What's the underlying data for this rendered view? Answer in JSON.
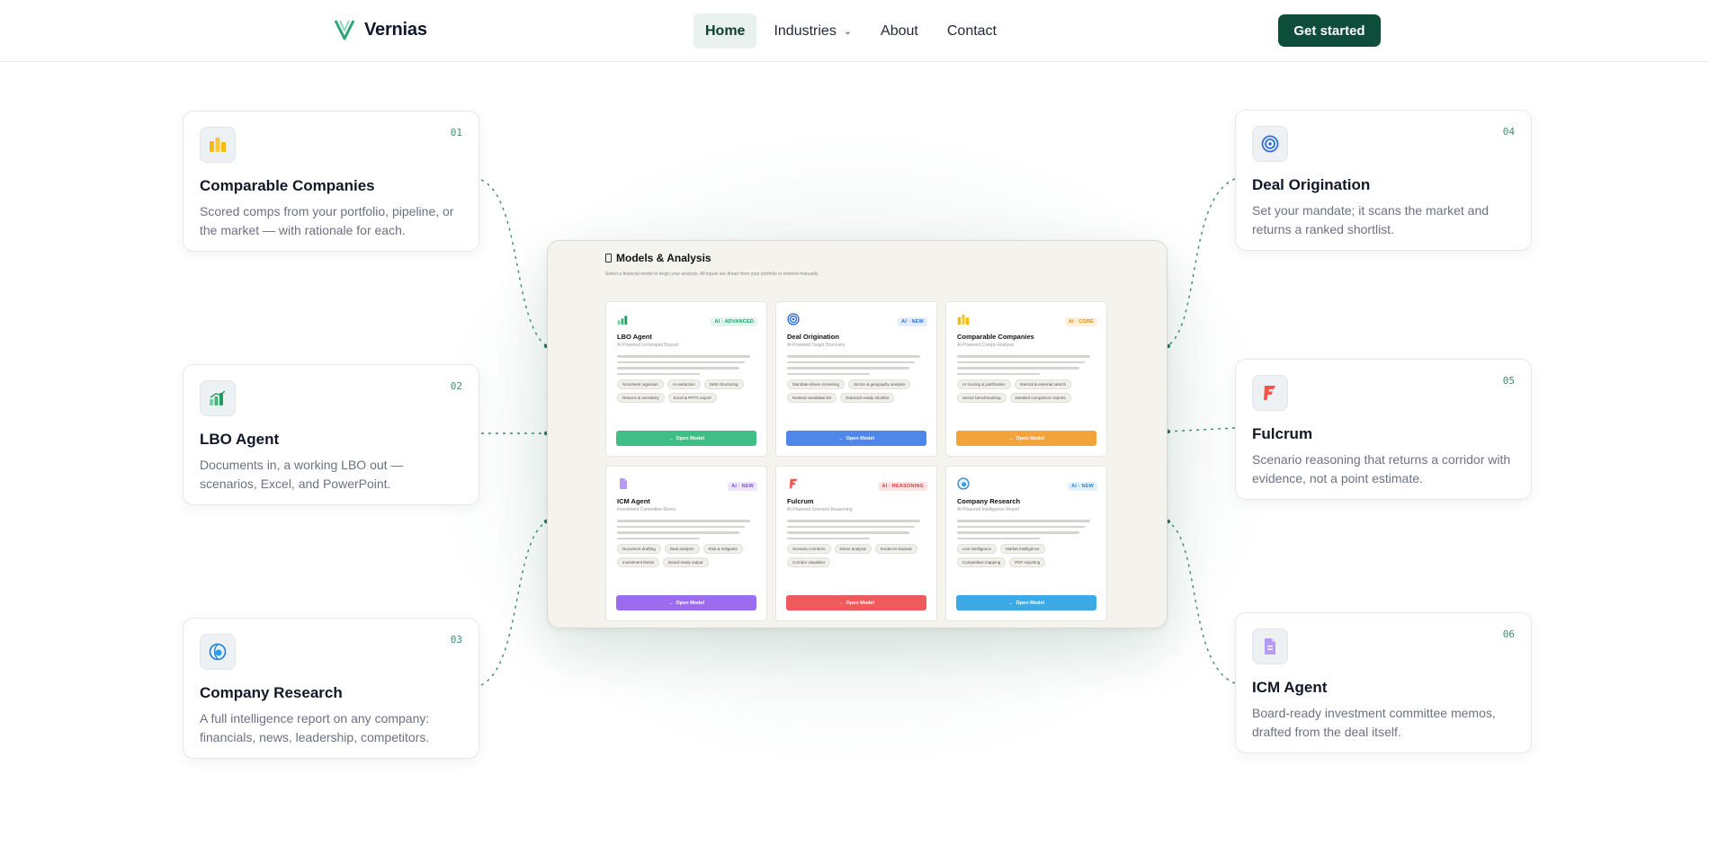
{
  "brand": {
    "name": "Vernias",
    "mark_color": "#2fa57a"
  },
  "nav": {
    "items": [
      {
        "label": "Home",
        "active": true
      },
      {
        "label": "Industries",
        "has_dropdown": true
      },
      {
        "label": "About"
      },
      {
        "label": "Contact"
      }
    ],
    "cta": "Get started"
  },
  "features": [
    {
      "num": "01",
      "title": "Comparable Companies",
      "desc": "Scored comps from your portfolio, pipeline, or the market — with rationale for each.",
      "icon": "bar-chart-icon"
    },
    {
      "num": "02",
      "title": "LBO Agent",
      "desc": "Documents in, a working LBO out — scenarios, Excel, and PowerPoint.",
      "icon": "growth-chart-icon"
    },
    {
      "num": "03",
      "title": "Company Research",
      "desc": "A full intelligence report on any company: financials, news, leadership, competitors.",
      "icon": "globe-icon"
    },
    {
      "num": "04",
      "title": "Deal Origination",
      "desc": "Set your mandate; it scans the market and returns a ranked shortlist.",
      "icon": "target-icon"
    },
    {
      "num": "05",
      "title": "Fulcrum",
      "desc": "Scenario reasoning that returns a corridor with evidence, not a point estimate.",
      "icon": "fulcrum-logo-icon"
    },
    {
      "num": "06",
      "title": "ICM Agent",
      "desc": "Board-ready investment committee memos, drafted from the deal itself.",
      "icon": "document-icon"
    }
  ],
  "screenshot": {
    "title": "Models & Analysis",
    "subtitle": "Select a financial model to begin your analysis. All inputs are drawn from your portfolio or entered manually.",
    "open_label": "Open Model",
    "models": [
      {
        "title": "LBO Agent",
        "sub": "AI-Powered Leveraged Buyout",
        "badge": "AI · ADVANCED",
        "badge_color": "#1f9d6b",
        "badge_bg": "#e3f5ec",
        "button_color": "#3fbf86",
        "icon": "growth-chart-icon",
        "tags": [
          "Document ingestion",
          "AI extraction",
          "Debt structuring",
          "Returns & sensitivity",
          "Excel & PPTX export"
        ]
      },
      {
        "title": "Deal Origination",
        "sub": "AI-Powered Target Discovery",
        "badge": "AI · NEW",
        "badge_color": "#2f6fe0",
        "badge_bg": "#e4edfc",
        "button_color": "#4f86ea",
        "icon": "target-icon",
        "tags": [
          "Mandate-driven screening",
          "Sector & geography analysis",
          "Ranked candidate list",
          "Outreach-ready shortlist"
        ]
      },
      {
        "title": "Comparable Companies",
        "sub": "AI-Powered Comps Analysis",
        "badge": "AI · CORE",
        "badge_color": "#e08a12",
        "badge_bg": "#fdf1dd",
        "button_color": "#f2a43a",
        "icon": "bar-chart-icon",
        "tags": [
          "AI scoring & justification",
          "Internal & external search",
          "Sector benchmarking",
          "Detailed comparison reports"
        ]
      },
      {
        "title": "ICM Agent",
        "sub": "Investment Committee Memo",
        "badge": "AI · NEW",
        "badge_color": "#7b4fe0",
        "badge_bg": "#ede6fc",
        "button_color": "#9b6cf0",
        "icon": "document-icon",
        "tags": [
          "Document drafting",
          "Deal analysis",
          "Risk & mitigants",
          "Investment thesis",
          "Board-ready output"
        ]
      },
      {
        "title": "Fulcrum",
        "sub": "AI-Powered Scenario Reasoning",
        "badge": "AI · REASONING",
        "badge_color": "#e03b3b",
        "badge_bg": "#fce4e4",
        "button_color": "#ef5a5a",
        "icon": "fulcrum-logo-icon",
        "tags": [
          "Scenario corridors",
          "Driver analysis",
          "Evidence-backed",
          "Corridor visualiser"
        ]
      },
      {
        "title": "Company Research",
        "sub": "AI-Powered Intelligence Report",
        "badge": "AI · NEW",
        "badge_color": "#1f88d0",
        "badge_bg": "#e2f1fb",
        "button_color": "#3aa9e6",
        "icon": "globe-icon",
        "tags": [
          "Live intelligence",
          "Market intelligence",
          "Competitive mapping",
          "PDF reporting"
        ]
      }
    ]
  }
}
